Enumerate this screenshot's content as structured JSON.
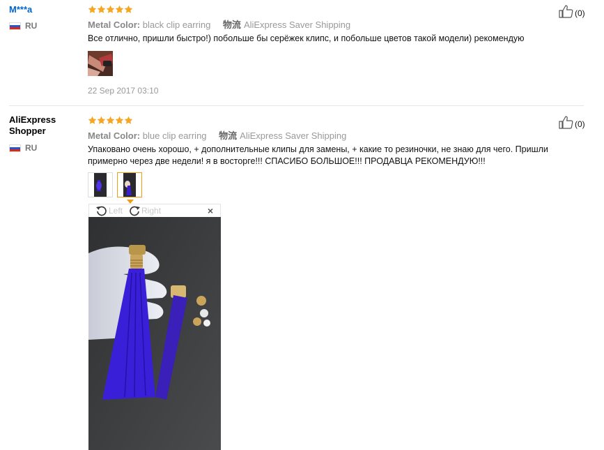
{
  "reviews": [
    {
      "user": "M***a",
      "country": "RU",
      "attr_label": "Metal Color:",
      "attr_value": "black clip earring",
      "ship_icon": "物流",
      "shipping": "AliExpress Saver Shipping",
      "text": "Все отлично, пришли быстро!) побольше бы серёжек клипс, и побольше цветов такой модели) рекомендую",
      "date": "22 Sep 2017 03:10",
      "helpful": "(0)"
    },
    {
      "user": "AliExpress Shopper",
      "country": "RU",
      "attr_label": "Metal Color:",
      "attr_value": "blue clip earring",
      "ship_icon": "物流",
      "shipping": "AliExpress Saver Shipping",
      "text": "Упаковано очень хорошо, + дополнительные клипы для замены, + какие то резиночки, не знаю для чего. Пришли примерно через две недели! я в восторге!!! СПАСИБО БОЛЬШОЕ!!! ПРОДАВЦА РЕКОМЕНДУЮ!!!",
      "helpful": "(0)"
    }
  ],
  "viewer": {
    "rotate_left": "Left",
    "rotate_right": "Right",
    "close": "×"
  },
  "colors": {
    "star": "#f5a623",
    "accent": "#f39c12",
    "link_blue": "#0066cc"
  },
  "icons": [
    "thumbs-up-icon",
    "star-icon",
    "rotate-left-icon",
    "rotate-right-icon",
    "close-icon",
    "russia-flag-icon"
  ]
}
